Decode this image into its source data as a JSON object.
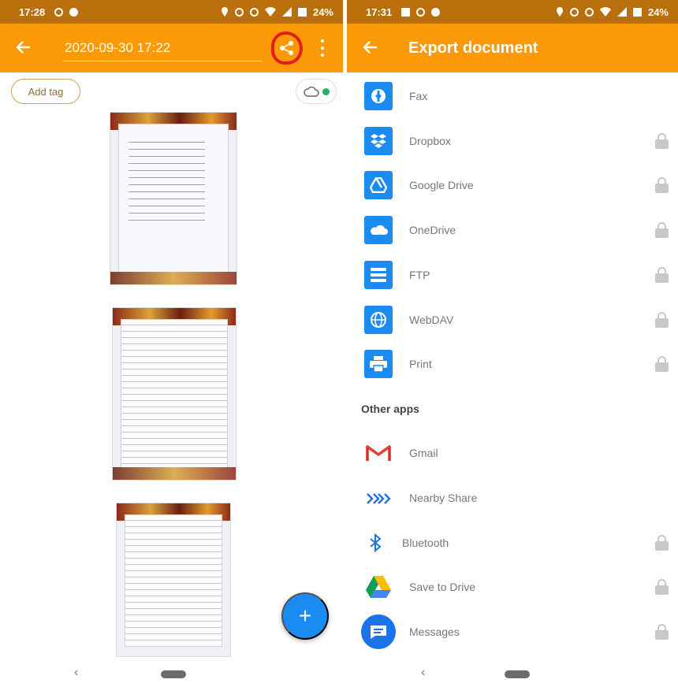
{
  "colors": {
    "accent": "#fb9a06",
    "status_bar": "#b96f0c",
    "tile_blue": "#1a8bf1",
    "highlight_circle": "#e0201c",
    "sync_dot": "#1fb35a"
  },
  "left": {
    "status_bar": {
      "time": "17:28",
      "battery": "24%"
    },
    "toolbar": {
      "back_icon": "arrow-left-icon",
      "title": "2020-09-30 17:22",
      "share_icon": "share-icon",
      "more_icon": "more-vertical-icon"
    },
    "add_tag_label": "Add tag",
    "cloud_icon": "cloud-icon",
    "pages": [
      "page-1",
      "page-2",
      "page-3"
    ],
    "fab": {
      "label": "+",
      "icon": "plus-icon"
    }
  },
  "right": {
    "status_bar": {
      "time": "17:31",
      "battery": "24%"
    },
    "toolbar": {
      "back_icon": "arrow-left-icon",
      "title": "Export document"
    },
    "export_items": [
      {
        "label": "Fax",
        "icon": "fax-icon",
        "locked": false
      },
      {
        "label": "Dropbox",
        "icon": "dropbox-icon",
        "locked": true
      },
      {
        "label": "Google Drive",
        "icon": "google-drive-icon",
        "locked": true
      },
      {
        "label": "OneDrive",
        "icon": "onedrive-icon",
        "locked": true
      },
      {
        "label": "FTP",
        "icon": "ftp-icon",
        "locked": true
      },
      {
        "label": "WebDAV",
        "icon": "webdav-icon",
        "locked": true
      },
      {
        "label": "Print",
        "icon": "print-icon",
        "locked": true
      }
    ],
    "other_apps_header": "Other apps",
    "other_apps": [
      {
        "label": "Gmail",
        "icon": "gmail-icon",
        "locked": false
      },
      {
        "label": "Nearby Share",
        "icon": "nearby-share-icon",
        "locked": false
      },
      {
        "label": "Bluetooth",
        "icon": "bluetooth-icon",
        "locked": true
      },
      {
        "label": "Save to Drive",
        "icon": "drive-icon",
        "locked": true
      },
      {
        "label": "Messages",
        "icon": "messages-icon",
        "locked": true
      }
    ]
  }
}
